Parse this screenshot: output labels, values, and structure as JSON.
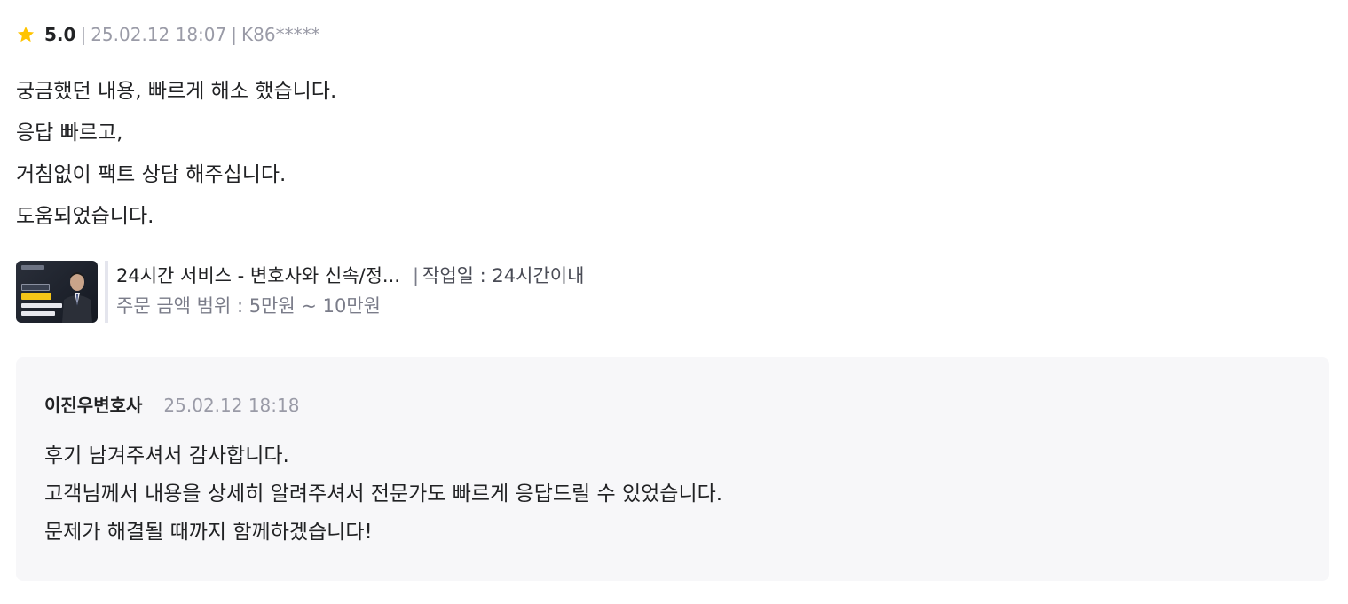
{
  "review": {
    "star_icon": "star-icon",
    "star_color": "#ffc400",
    "rating": "5.0",
    "separator": "|",
    "date": "25.02.12 18:07",
    "user": "K86*****",
    "lines": [
      "궁금했던 내용, 빠르게 해소 했습니다.",
      "응답 빠르고,",
      "거침없이 팩트 상담 해주십니다.",
      "도움되었습니다."
    ]
  },
  "service": {
    "title": "24시간 서비스 - 변호사와 신속/정...",
    "separator": "|",
    "work_period": "작업일 : 24시간이내",
    "price_range": "주문 금액 범위 : 5만원 ~ 10만원",
    "thumbnail_icon": "service-thumbnail-image"
  },
  "reply": {
    "author": "이진우변호사",
    "date": "25.02.12 18:18",
    "lines": [
      "후기 남겨주셔서 감사합니다.",
      "고객님께서 내용을 상세히 알려주셔서 전문가도 빠르게 응답드릴 수 있었습니다.",
      "문제가 해결될 때까지 함께하겠습니다!"
    ]
  }
}
